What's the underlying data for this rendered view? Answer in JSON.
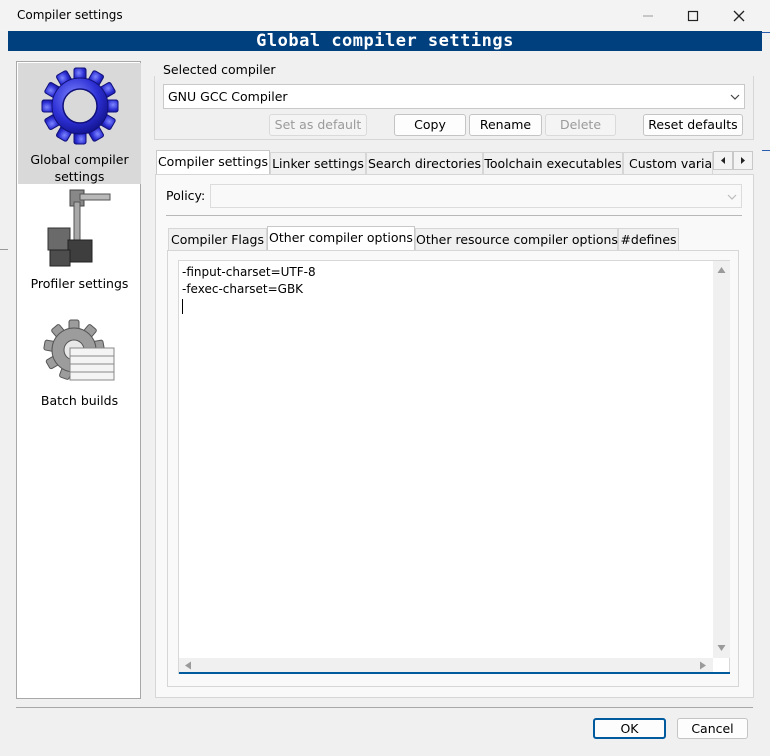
{
  "window": {
    "title": "Compiler settings"
  },
  "banner": {
    "title": "Global compiler settings"
  },
  "categories": [
    {
      "label": "Global compiler settings",
      "icon": "gear-icon",
      "selected": true
    },
    {
      "label": "Profiler settings",
      "icon": "caliper-icon",
      "selected": false
    },
    {
      "label": "Batch builds",
      "icon": "batch-gear-icon",
      "selected": false
    }
  ],
  "compiler": {
    "group_label": "Selected compiler",
    "selected": "GNU GCC Compiler",
    "buttons": {
      "set_default": "Set as default",
      "copy": "Copy",
      "rename": "Rename",
      "delete": "Delete",
      "reset": "Reset defaults"
    }
  },
  "main_tabs": [
    "Compiler settings",
    "Linker settings",
    "Search directories",
    "Toolchain executables",
    "Custom variab"
  ],
  "policy": {
    "label": "Policy:",
    "value": ""
  },
  "sub_tabs": [
    "Compiler Flags",
    "Other compiler options",
    "Other resource compiler options",
    "#defines"
  ],
  "editor": {
    "lines": [
      "-finput-charset=UTF-8",
      "-fexec-charset=GBK"
    ]
  },
  "footer": {
    "ok": "OK",
    "cancel": "Cancel"
  },
  "colors": {
    "banner": "#00407f",
    "accent": "#005a9e"
  }
}
